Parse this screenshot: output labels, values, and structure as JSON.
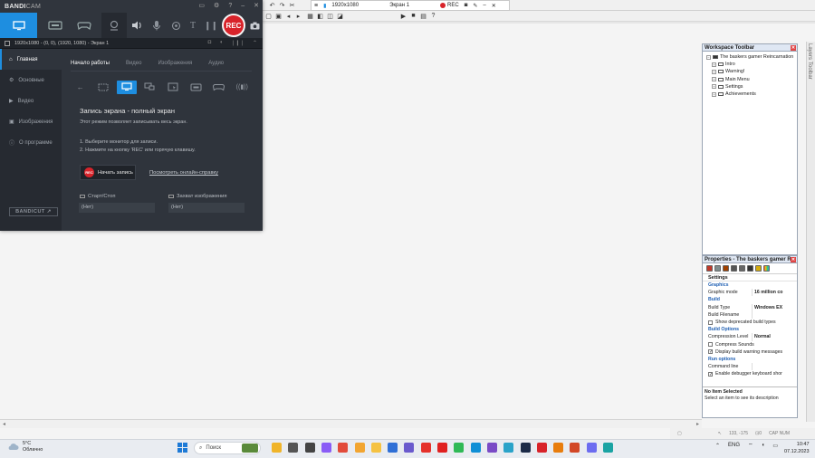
{
  "bandicam": {
    "logo_main": "BANDI",
    "logo_cam": "CAM",
    "rec_label": "REC",
    "info_bar": "1920x1080 - (0, 0), (1920, 1080) - Экран 1",
    "sidebar": [
      {
        "label": "Главная",
        "icon": "home-icon",
        "active": true
      },
      {
        "label": "Основные",
        "icon": "gear-icon",
        "active": false
      },
      {
        "label": "Видео",
        "icon": "video-icon",
        "active": false
      },
      {
        "label": "Изображения",
        "icon": "image-icon",
        "active": false
      },
      {
        "label": "О программе",
        "icon": "info-icon",
        "active": false
      }
    ],
    "bandicut_label": "BANDICUT ↗",
    "tabs": [
      "Начало работы",
      "Видео",
      "Изображения",
      "Аудио"
    ],
    "main": {
      "title": "Запись экрана - полный экран",
      "desc": "Этот режим позволяет записывать весь экран.",
      "step1": "1. Выберите монитор для записи.",
      "step2": "2. Нажмите на кнопку 'REC' или горячую клавишу.",
      "start_rec_icon": "REC",
      "start_rec": "Начать запись",
      "help_link": "Посмотреть онлайн-справку",
      "hotkey_start_label": "Старт/Стоп",
      "hotkey_start_value": "(Нет)",
      "hotkey_capture_label": "Захват изображения",
      "hotkey_capture_value": "(Нет)"
    },
    "accent": "#1e8ee0",
    "rec_color": "#d8232a"
  },
  "rec_bar": {
    "resolution": "1920x1080",
    "screen": "Экран 1",
    "rec": "REC"
  },
  "right_strip": {
    "label1": "Layers",
    "label2": "Toolbar"
  },
  "workspace": {
    "title": "Workspace Toolbar",
    "root": "The baskers gamer Reincarnation",
    "items": [
      "Intro",
      "Warning!",
      "Main Menu",
      "Settings",
      "Achievements"
    ]
  },
  "properties": {
    "title": "Properties - The baskers gamer R...",
    "header": "Settings",
    "rows": [
      {
        "type": "section",
        "label": "Graphics"
      },
      {
        "type": "kv",
        "key": "Graphic mode",
        "value": "16 million co"
      },
      {
        "type": "section",
        "label": "Build"
      },
      {
        "type": "kv",
        "key": "Build Type",
        "value": "Windows EX"
      },
      {
        "type": "kv",
        "key": "Build Filename",
        "value": ""
      },
      {
        "type": "check",
        "label": "Show deprecated build types",
        "checked": false
      },
      {
        "type": "section",
        "label": "Build Options"
      },
      {
        "type": "kv",
        "key": "Compression Level",
        "value": "Normal"
      },
      {
        "type": "check",
        "label": "Compress Sounds",
        "checked": false
      },
      {
        "type": "check",
        "label": "Display build warning messages",
        "checked": true
      },
      {
        "type": "section",
        "label": "Run options"
      },
      {
        "type": "kv",
        "key": "Command line",
        "value": ""
      },
      {
        "type": "check",
        "label": "Enable debugger keyboard shor",
        "checked": true
      }
    ],
    "footer_title": "No Item Selected",
    "footer_desc": "Select an item to see its description"
  },
  "host_status": {
    "coords": "133, -175",
    "sel": "0",
    "mode": "CAP NUM"
  },
  "taskbar": {
    "temp": "5°C",
    "weather": "Облачно",
    "search": "Поиск",
    "lang": "ENG",
    "time": "10:47",
    "date": "07.12.2023"
  }
}
